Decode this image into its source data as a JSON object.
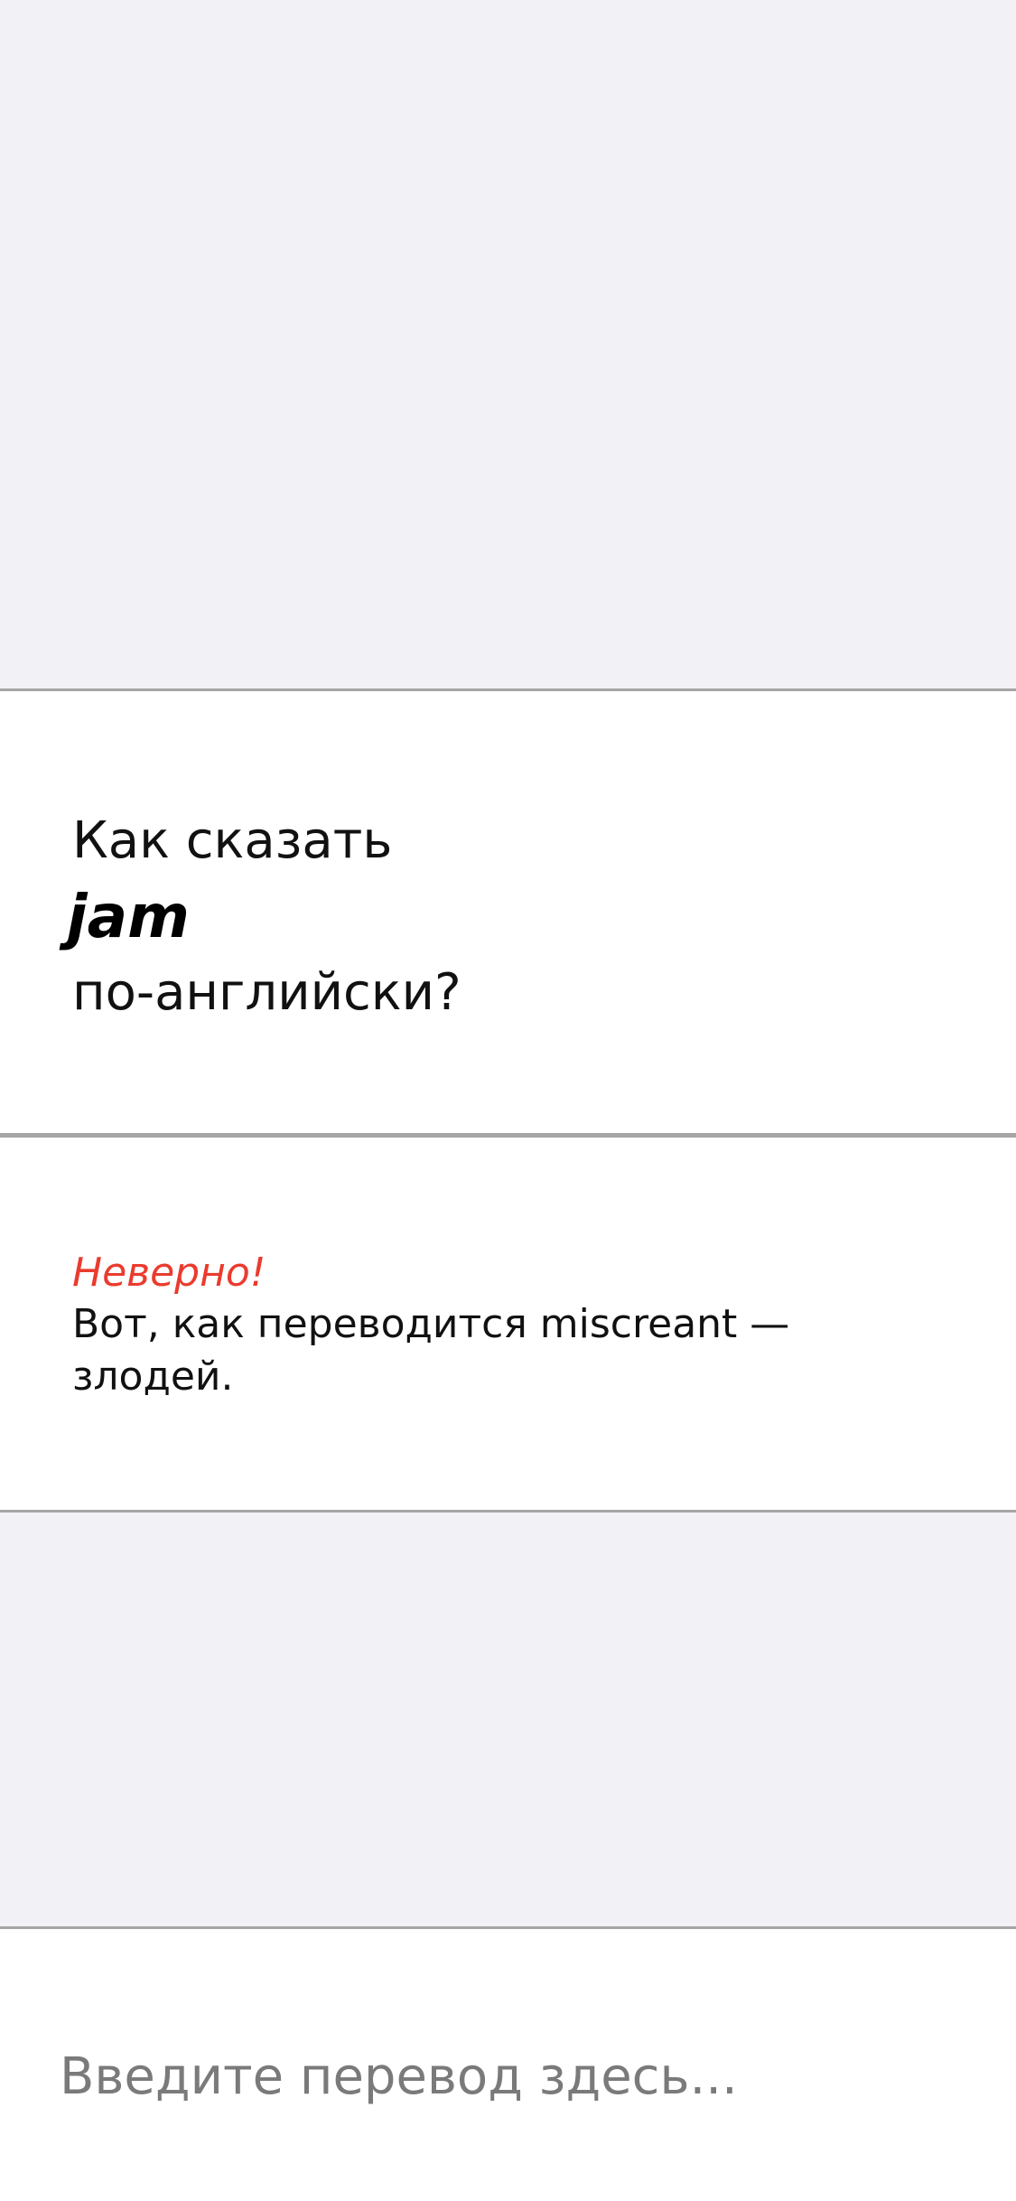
{
  "question": {
    "prefix": "Как сказать",
    "word": "jam",
    "suffix": "по-английски?"
  },
  "feedback": {
    "status": "Неверно!",
    "explanation": "Вот, как переводится miscreant — злодей.",
    "status_color": "#ea3b2e"
  },
  "input": {
    "placeholder": "Введите перевод здесь...",
    "value": ""
  },
  "colors": {
    "background": "#f1f1f6",
    "card": "#ffffff",
    "divider": "#a5a5a5"
  }
}
